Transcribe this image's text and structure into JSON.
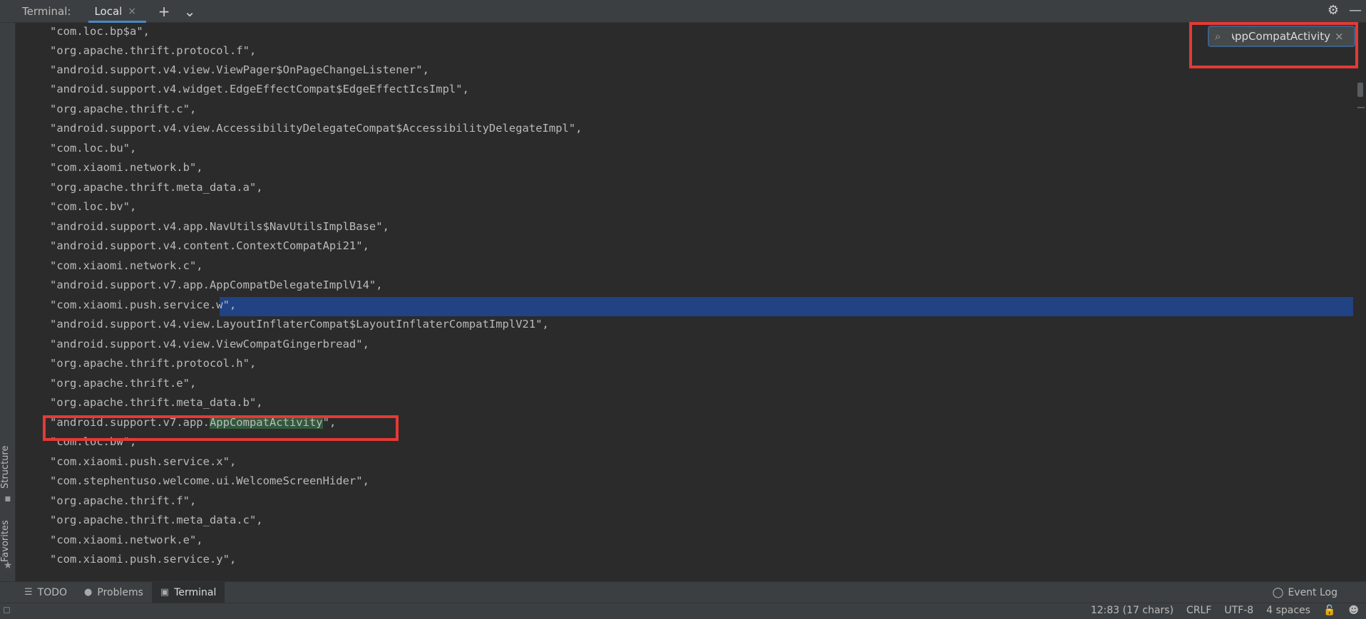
{
  "header": {
    "title": "Terminal:",
    "tab_label": "Local",
    "tab_close": "×",
    "add": "+",
    "dropdown": "⌄",
    "settings": "⚙",
    "minimize": "—"
  },
  "side": {
    "structure": "Structure",
    "favorites": "Favorites"
  },
  "search": {
    "value": "AppCompatActivity",
    "clear": "×"
  },
  "lines": [
    "\"com.loc.bp$a\",",
    "\"org.apache.thrift.protocol.f\",",
    "\"android.support.v4.view.ViewPager$OnPageChangeListener\",",
    "\"android.support.v4.widget.EdgeEffectCompat$EdgeEffectIcsImpl\",",
    "\"org.apache.thrift.c\",",
    "\"android.support.v4.view.AccessibilityDelegateCompat$AccessibilityDelegateImpl\",",
    "\"com.loc.bu\",",
    "\"com.xiaomi.network.b\",",
    "\"org.apache.thrift.meta_data.a\",",
    "\"com.loc.bv\",",
    "\"android.support.v4.app.NavUtils$NavUtilsImplBase\",",
    "\"android.support.v4.content.ContextCompatApi21\",",
    "\"com.xiaomi.network.c\",",
    "\"android.support.v7.app.AppCompatDelegateImplV14\",",
    "\"com.xiaomi.push.service.w\",",
    "\"android.support.v4.view.LayoutInflaterCompat$LayoutInflaterCompatImplV21\",",
    "\"android.support.v4.view.ViewCompatGingerbread\",",
    "\"org.apache.thrift.protocol.h\",",
    "\"org.apache.thrift.e\",",
    "\"org.apache.thrift.meta_data.b\",",
    "",
    "\"com.loc.bw\",",
    "\"com.xiaomi.push.service.x\",",
    "\"com.stephentuso.welcome.ui.WelcomeScreenHider\",",
    "\"org.apache.thrift.f\",",
    "\"org.apache.thrift.meta_data.c\",",
    "\"com.xiaomi.network.e\",",
    "\"com.xiaomi.push.service.y\","
  ],
  "match_line": {
    "prefix": "\"android.support.v7.app.",
    "match": "AppCompatActivity",
    "suffix": "\","
  },
  "toolbar": {
    "todo": "TODO",
    "problems": "Problems",
    "terminal": "Terminal",
    "event_log": "Event Log"
  },
  "status": {
    "position": "12:83 (17 chars)",
    "line_sep": "CRLF",
    "encoding": "UTF-8",
    "indent": "4 spaces"
  }
}
